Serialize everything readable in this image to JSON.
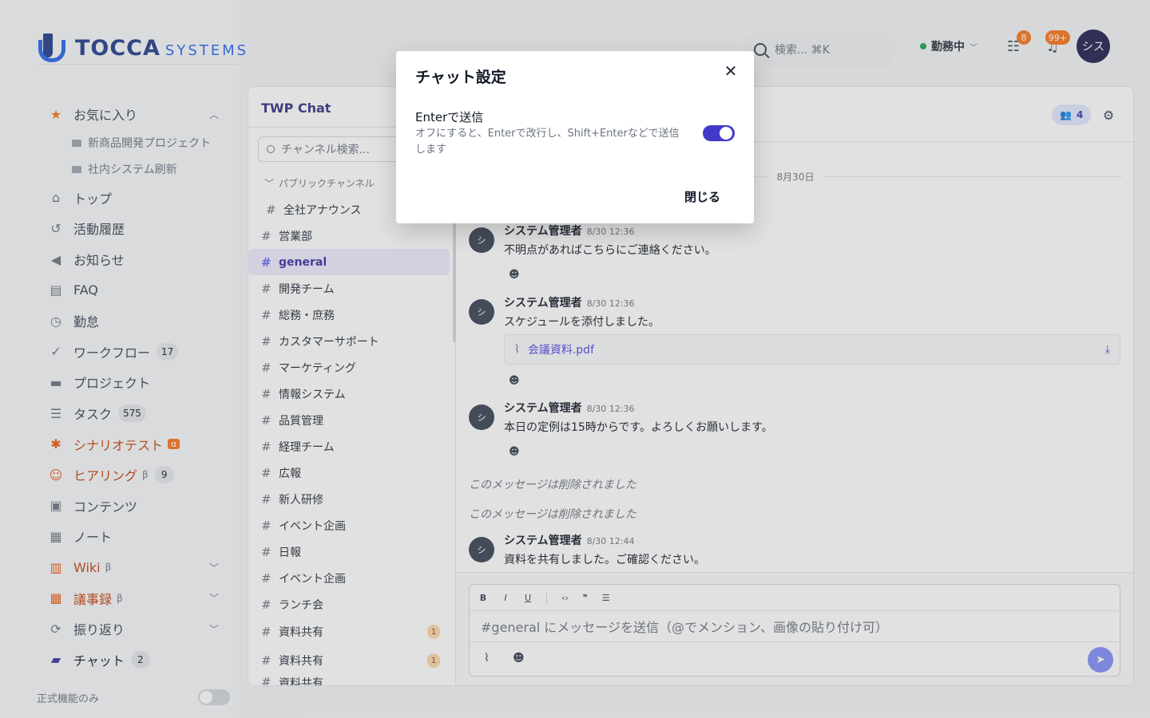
{
  "brand": {
    "name": "TOCCA",
    "suffix": "SYSTEMS"
  },
  "nav": {
    "favorites": {
      "label": "お気に入り",
      "items": [
        "新商品開発プロジェクト",
        "社内システム刷新"
      ]
    },
    "items": [
      {
        "label": "トップ"
      },
      {
        "label": "活動履歴"
      },
      {
        "label": "お知らせ"
      },
      {
        "label": "FAQ"
      },
      {
        "label": "勤怠"
      },
      {
        "label": "ワークフロー",
        "badge": "17"
      },
      {
        "label": "プロジェクト"
      },
      {
        "label": "タスク",
        "badge": "575"
      },
      {
        "label": "シナリオテスト",
        "greek": "α"
      },
      {
        "label": "ヒアリング",
        "greek": "β",
        "badge": "9"
      },
      {
        "label": "コンテンツ"
      },
      {
        "label": "ノート"
      },
      {
        "label": "Wiki",
        "greek": "β"
      },
      {
        "label": "議事録",
        "greek": "β"
      },
      {
        "label": "振り返り"
      },
      {
        "label": "チャット",
        "badge": "2"
      }
    ],
    "bottom_toggle_label": "正式機能のみ"
  },
  "topbar": {
    "search_placeholder": "検索... ⌘K",
    "status": "勤務中",
    "tasks_badge": "8",
    "notif_badge": "99+",
    "avatar": "シス"
  },
  "chat": {
    "title": "TWP Chat",
    "search_placeholder": "チャンネル検索...",
    "group_label": "パブリックチャンネル",
    "channels": [
      {
        "name": "全社アナウンス"
      },
      {
        "name": "営業部"
      },
      {
        "name": "general"
      },
      {
        "name": "開発チーム"
      },
      {
        "name": "総務・庶務"
      },
      {
        "name": "カスタマーサポート"
      },
      {
        "name": "マーケティング"
      },
      {
        "name": "情報システム"
      },
      {
        "name": "品質管理"
      },
      {
        "name": "経理チーム"
      },
      {
        "name": "広報"
      },
      {
        "name": "新人研修"
      },
      {
        "name": "イベント企画"
      },
      {
        "name": "日報"
      },
      {
        "name": "イベント企画"
      },
      {
        "name": "ランチ会"
      },
      {
        "name": "資料共有",
        "count": "1"
      },
      {
        "name": "資料共有",
        "count": "1"
      },
      {
        "name": "資料共有"
      }
    ],
    "members_count": "4",
    "date_label": "8月30日",
    "messages": [
      {
        "avatar": "シ",
        "author": "システム管理者",
        "time": "8/30 12:36",
        "text": "不明点があればこちらにご連絡ください。"
      },
      {
        "avatar": "シ",
        "author": "システム管理者",
        "time": "8/30 12:36",
        "text": "スケジュールを添付しました。",
        "attachment": "会議資料.pdf"
      },
      {
        "avatar": "シ",
        "author": "システム管理者",
        "time": "8/30 12:36",
        "text": "本日の定例は15時からです。よろしくお願いします。"
      },
      {
        "avatar": "シ",
        "author": "システム管理者",
        "time": "8/30 12:44",
        "text": "資料を共有しました。ご確認ください。"
      }
    ],
    "deleted_text": "このメッセージは削除されました",
    "composer_placeholder": "#general にメッセージを送信（@でメンション、画像の貼り付け可）"
  },
  "modal": {
    "title": "チャット設定",
    "option_label": "Enterで送信",
    "option_desc": "オフにすると、Enterで改行し、Shift+Enterなどで送信します",
    "close_button": "閉じる"
  }
}
